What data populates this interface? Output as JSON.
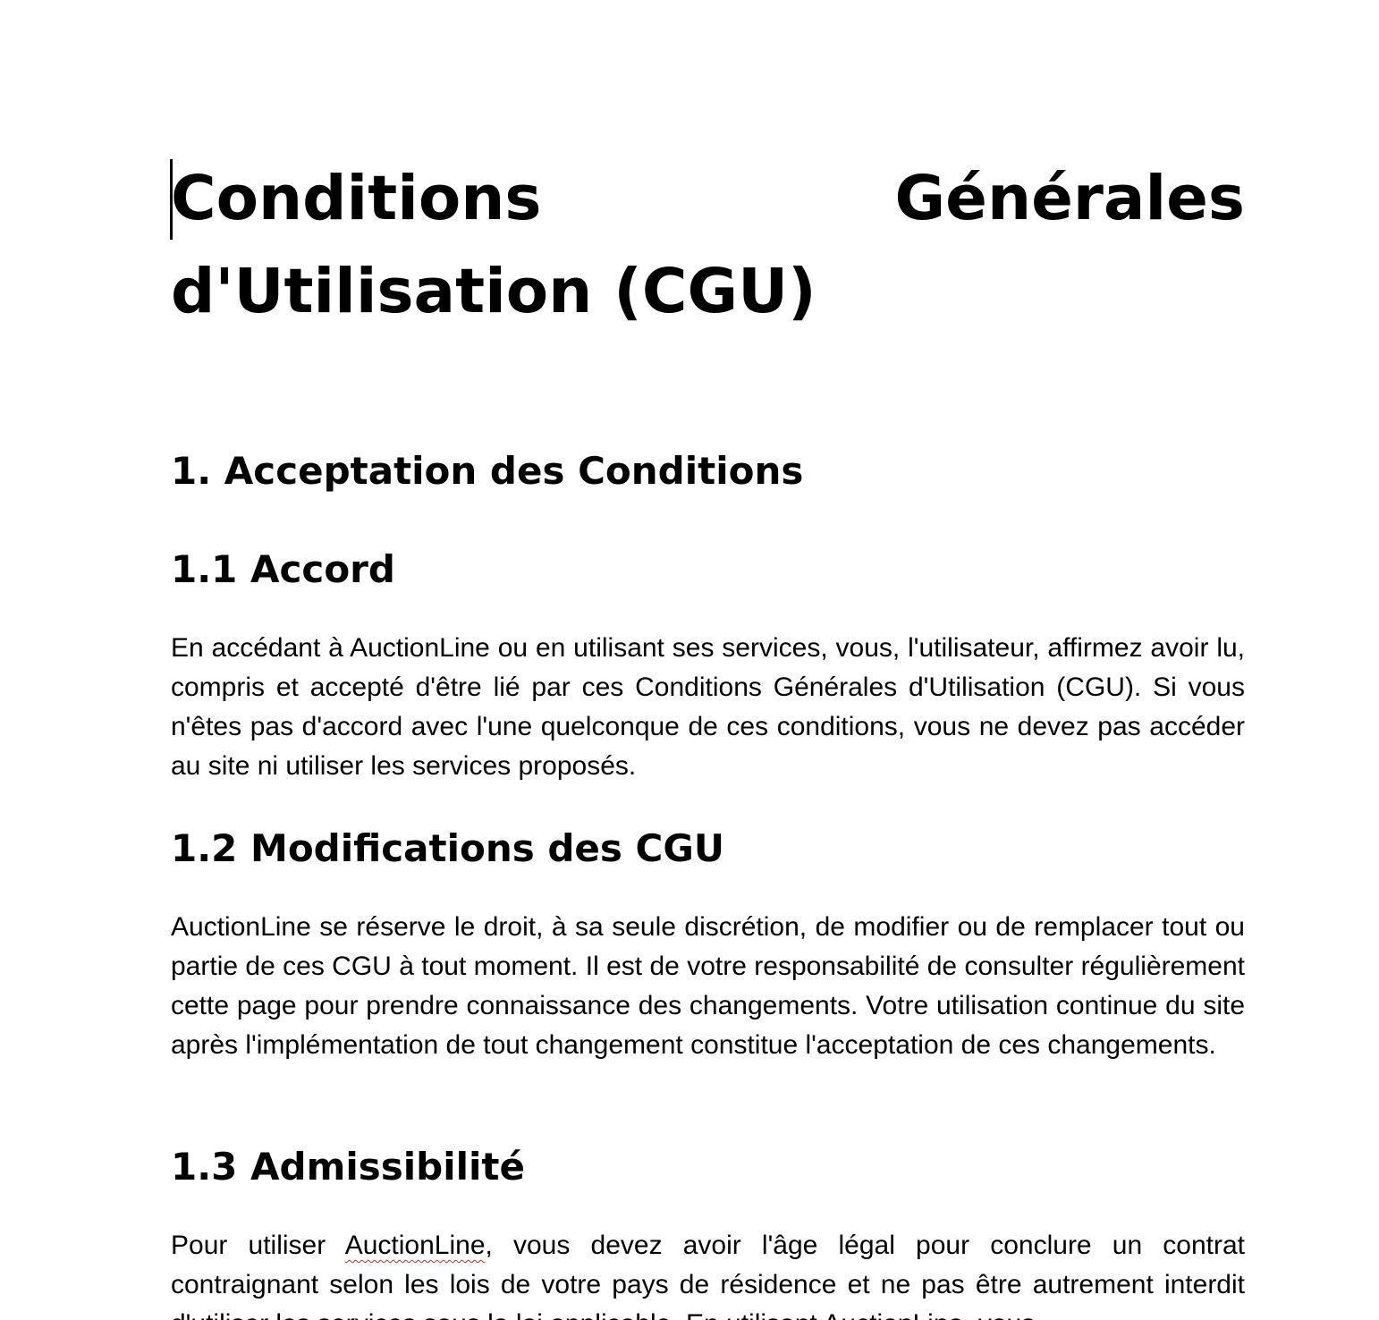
{
  "document": {
    "title": "Conditions Générales d'Utilisation (CGU)",
    "section1": {
      "heading": "1. Acceptation des Conditions",
      "sub1": {
        "heading": "1.1 Accord",
        "text": "En accédant à AuctionLine ou en utilisant ses services, vous, l'utilisateur, affirmez avoir lu, compris et accepté d'être lié par ces Conditions Générales d'Utilisation (CGU). Si vous n'êtes pas d'accord avec l'une quelconque de ces conditions, vous ne devez pas accéder au site ni utiliser les services proposés."
      },
      "sub2": {
        "heading": "1.2 Modifications des CGU",
        "text": "AuctionLine se réserve le droit, à sa seule discrétion, de modifier ou de remplacer tout ou partie de ces CGU à tout moment. Il est de votre responsabilité de consulter régulièrement cette page pour prendre connaissance des changements. Votre utilisation continue du site après l'implémentation de tout changement constitue l'acceptation de ces changements."
      },
      "sub3": {
        "heading": "1.3 Admissibilité",
        "text_before": "Pour utiliser ",
        "text_flagged": "AuctionLine",
        "text_after": ", vous devez avoir l'âge légal pour conclure un contrat contraignant selon les lois de votre pays de résidence et ne pas être autrement interdit d'utiliser les services sous la loi applicable. En utilisant AuctionLine, vous"
      }
    }
  }
}
